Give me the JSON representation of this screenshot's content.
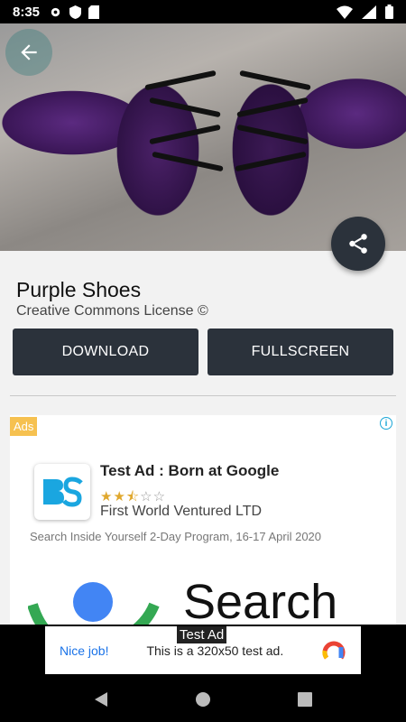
{
  "status_bar": {
    "time": "8:35"
  },
  "detail": {
    "title": "Purple Shoes",
    "license": "Creative Commons License ©",
    "download_label": "DOWNLOAD",
    "fullscreen_label": "FULLSCREEN"
  },
  "ad": {
    "badge": "Ads",
    "title": "Test Ad : Born at Google",
    "rating": 2.5,
    "advertiser": "First World Ventured LTD",
    "description": "Search Inside Yourself 2-Day Program, 16-17 April 2020",
    "search_text": "Search"
  },
  "banner_ad": {
    "label": "Test Ad",
    "nice": "Nice job!",
    "message": "This is a 320x50 test ad."
  },
  "colors": {
    "button_bg": "#2b323b",
    "ads_badge": "#f6c150",
    "link_blue": "#1a73e8"
  }
}
